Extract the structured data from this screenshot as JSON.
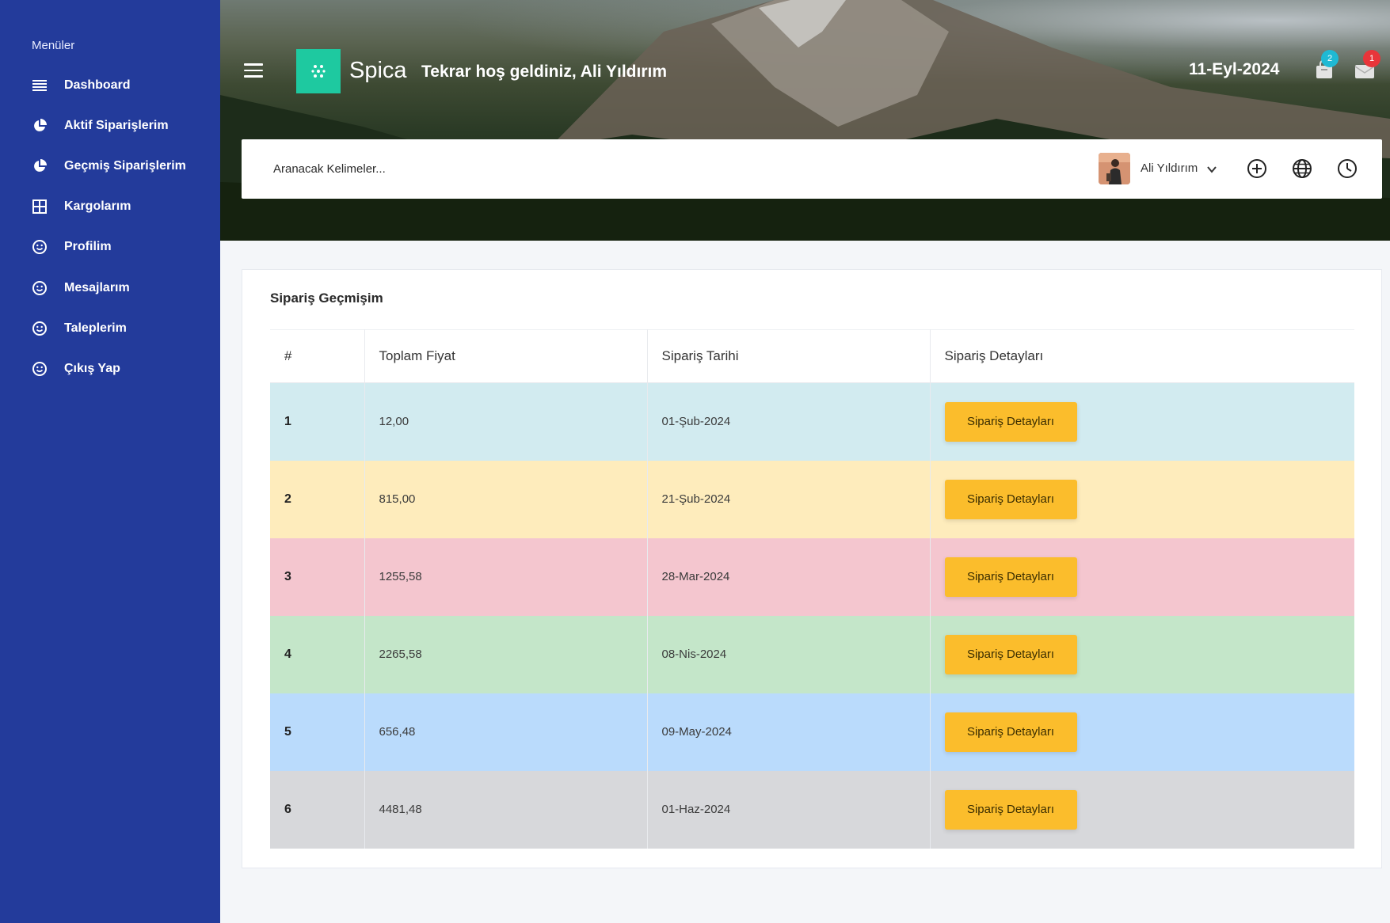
{
  "sidebar": {
    "title": "Menüler",
    "items": [
      {
        "label": "Dashboard",
        "icon": "list-icon"
      },
      {
        "label": "Aktif Siparişlerim",
        "icon": "pie-chart-icon"
      },
      {
        "label": "Geçmiş Siparişlerim",
        "icon": "pie-chart-icon"
      },
      {
        "label": "Kargolarım",
        "icon": "grid-icon"
      },
      {
        "label": "Profilim",
        "icon": "smile-icon"
      },
      {
        "label": "Mesajlarım",
        "icon": "smile-icon"
      },
      {
        "label": "Taleplerim",
        "icon": "smile-icon"
      },
      {
        "label": "Çıkış Yap",
        "icon": "smile-icon"
      }
    ]
  },
  "header": {
    "brand": "Spica",
    "welcome": "Tekrar hoş geldiniz, Ali Yıldırım",
    "date": "11-Eyl-2024",
    "cart_badge": "2",
    "mail_badge": "1"
  },
  "search": {
    "placeholder": "Aranacak Kelimeler...",
    "user_name": "Ali Yıldırım"
  },
  "orders": {
    "title": "Sipariş Geçmişim",
    "columns": [
      "#",
      "Toplam Fiyat",
      "Sipariş Tarihi",
      "Sipariş Detayları"
    ],
    "rows": [
      {
        "num": "1",
        "price": "12,00",
        "date": "01-Şub-2024",
        "button": "Sipariş Detayları",
        "color": "#d2ebf0"
      },
      {
        "num": "2",
        "price": "815,00",
        "date": "21-Şub-2024",
        "button": "Sipariş Detayları",
        "color": "#feecbc"
      },
      {
        "num": "3",
        "price": "1255,58",
        "date": "28-Mar-2024",
        "button": "Sipariş Detayları",
        "color": "#f4c6cf"
      },
      {
        "num": "4",
        "price": "2265,58",
        "date": "08-Nis-2024",
        "button": "Sipariş Detayları",
        "color": "#c4e6c9"
      },
      {
        "num": "5",
        "price": "656,48",
        "date": "09-May-2024",
        "button": "Sipariş Detayları",
        "color": "#badbfc"
      },
      {
        "num": "6",
        "price": "4481,48",
        "date": "01-Haz-2024",
        "button": "Sipariş Detayları",
        "color": "#d7d8db"
      }
    ]
  },
  "colors": {
    "sidebar": "#233b9b",
    "logo": "#1ec9a0",
    "button": "#fbbd2c",
    "badge_cart": "#1fb9d4",
    "badge_mail": "#e8353a"
  }
}
